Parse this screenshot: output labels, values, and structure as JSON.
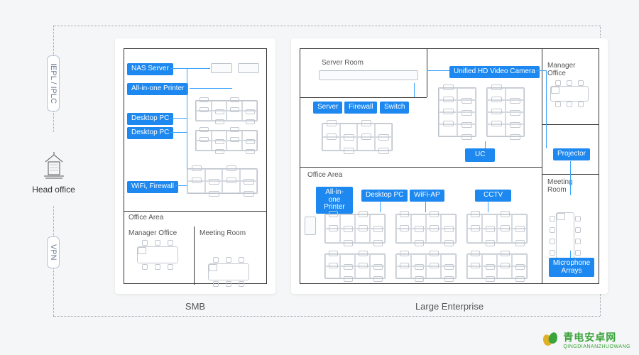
{
  "connections": {
    "iepl": "IEPL / IPLC",
    "vpn": "VPN"
  },
  "head_office": "Head office",
  "captions": {
    "smb": "SMB",
    "ent": "Large Enterprise"
  },
  "smb": {
    "nas": "NAS Server",
    "printer": "All-in-one Printer",
    "desktop1": "Desktop PC",
    "desktop2": "Desktop PC",
    "wifi": "WiFi, Firewall",
    "office_area": "Office Area",
    "manager": "Manager Office",
    "meeting": "Meeting Room"
  },
  "ent": {
    "server_room": "Server Room",
    "server": "Server",
    "firewall": "Firewall",
    "switch": "Switch",
    "camera": "Unified HD Video Camera",
    "manager": "Manager\nOffice",
    "uc": "UC",
    "projector": "Projector",
    "office_area": "Office Area",
    "printer": "All-in-one\nPrinter",
    "desktop": "Desktop PC",
    "wifi_ap": "WiFi-AP",
    "cctv": "CCTV",
    "meeting": "Meeting\nRoom",
    "mic": "Microphone\nArrays"
  },
  "watermark": {
    "cn": "青电安卓网",
    "en": "QINGDIANANZHUOWANG"
  }
}
